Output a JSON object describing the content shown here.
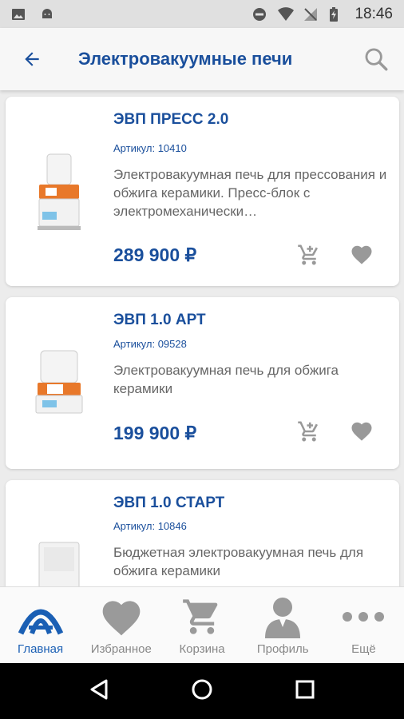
{
  "status_bar": {
    "time": "18:46"
  },
  "app_bar": {
    "title": "Электровакуумные печи"
  },
  "products": [
    {
      "name": "ЭВП ПРЕСС 2.0",
      "sku": "Артикул: 10410",
      "description": "Электровакуумная печь для прессования и обжига керамики. Пресс-блок с электромеханически…",
      "price": "289 900 ₽"
    },
    {
      "name": "ЭВП 1.0 АРТ",
      "sku": "Артикул: 09528",
      "description": "Электровакуумная печь для обжига керамики",
      "price": "199 900 ₽"
    },
    {
      "name": "ЭВП 1.0 СТАРТ",
      "sku": "Артикул: 10846",
      "description": "Бюджетная электровакуумная печь для обжига керамики",
      "price": ""
    }
  ],
  "bottom_nav": {
    "items": [
      {
        "label": "Главная",
        "icon": "home-logo-icon",
        "active": true
      },
      {
        "label": "Избранное",
        "icon": "heart-icon"
      },
      {
        "label": "Корзина",
        "icon": "cart-icon"
      },
      {
        "label": "Профиль",
        "icon": "person-icon"
      },
      {
        "label": "Ещё",
        "icon": "more-dots-icon"
      }
    ]
  },
  "colors": {
    "accent": "#1a4f9c",
    "active_nav": "#1a5fb4",
    "icon_gray": "#9a9a9a",
    "furnace_orange": "#e8782a"
  }
}
